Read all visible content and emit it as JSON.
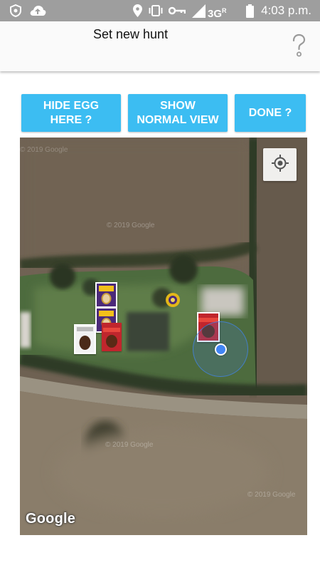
{
  "status_bar": {
    "network": "3G",
    "network_sup": "R",
    "time": "4:03 p.m.",
    "icons": [
      "shield-icon",
      "cloud-upload-icon",
      "location-pin-icon",
      "vibrate-icon",
      "key-icon",
      "signal-icon",
      "battery-icon"
    ]
  },
  "header": {
    "title": "Set new hunt",
    "help_icon": "question-mark-icon"
  },
  "toolbar": {
    "hide_egg_label": "HIDE EGG\nHERE ?",
    "show_view_label": "SHOW\nNORMAL VIEW",
    "done_label": "DONE ?",
    "button_color": "#3cbdf2"
  },
  "map": {
    "attribution": "Google",
    "watermark": "© 2019 Google",
    "locate_icon": "my-location-icon",
    "markers": [
      {
        "name": "creme-egg-box-marker",
        "icon": "egg-box-icon"
      },
      {
        "name": "creme-egg-box-marker",
        "icon": "egg-box-icon"
      },
      {
        "name": "chocolate-egg-marker",
        "icon": "egg-icon"
      },
      {
        "name": "maltesers-egg-marker",
        "icon": "egg-box-icon"
      },
      {
        "name": "golden-egg-marker",
        "icon": "egg-icon"
      },
      {
        "name": "maltesers-egg-marker",
        "icon": "egg-box-icon"
      }
    ]
  }
}
